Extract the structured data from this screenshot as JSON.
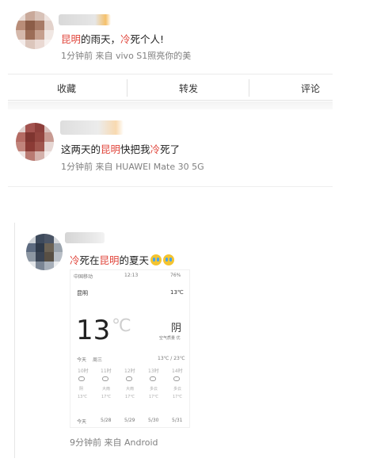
{
  "post1": {
    "content_pre": "",
    "content_hl1": "昆明",
    "content_mid": "的雨天，",
    "content_hl2": "冷",
    "content_post": "死个人!",
    "meta": "1分钟前  来自 vivo S1照亮你的美"
  },
  "actions": {
    "favorite": "收藏",
    "repost": "转发",
    "comment": "评论"
  },
  "post2": {
    "content_pre": "这两天的",
    "content_hl1": "昆明",
    "content_mid": "快把我",
    "content_hl2": "冷",
    "content_post": "死了",
    "meta": "1分钟前  来自 HUAWEI Mate 30 5G"
  },
  "post3": {
    "content_hl1": "冷",
    "content_mid": "死在",
    "content_hl2": "昆明",
    "content_post": "的夏天",
    "meta": "9分钟前  来自 Android",
    "emoji_icons": [
      "crying-face-icon",
      "crying-face-icon"
    ]
  },
  "phone_screenshot": {
    "status_left": "中国移动",
    "status_time": "12:13",
    "status_right": "76%",
    "city": "昆明",
    "city_temp": "13℃",
    "temp": "13",
    "temp_unit": "℃",
    "condition": "阴",
    "aqi": "空气质量 优",
    "today_label": "今天",
    "weekday": "周三",
    "range": "13℃ / 23℃",
    "hours": [
      "10时",
      "11时",
      "12时",
      "13时",
      "14时"
    ],
    "hour_conds": [
      "阴",
      "大雨",
      "大雨",
      "多云",
      "多云"
    ],
    "hour_temps": [
      "13℃",
      "17℃",
      "17℃",
      "17℃",
      "17℃"
    ],
    "days": [
      "今天",
      "5/28",
      "5/29",
      "5/30",
      "5/31"
    ]
  }
}
